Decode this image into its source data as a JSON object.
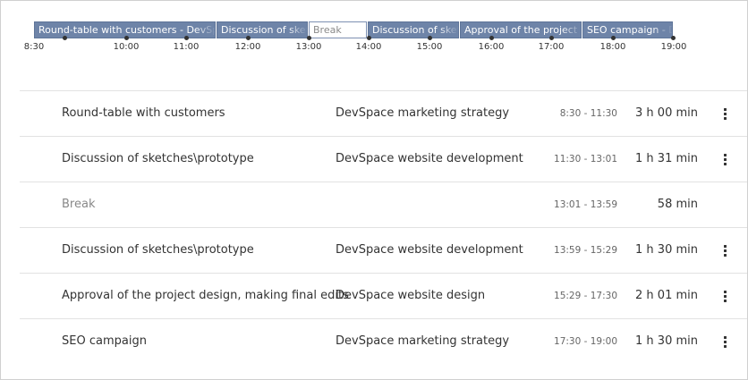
{
  "timeline": {
    "segments": [
      {
        "label": "Round-table with customers - DevSpace marketing strategy"
      },
      {
        "label": "Discussion of sketches\\prototype"
      },
      {
        "label": "Break"
      },
      {
        "label": "Discussion of sketches\\prototype"
      },
      {
        "label": "Approval of the project design, making final edits"
      },
      {
        "label": "SEO campaign - DevSpace marketing strategy"
      }
    ],
    "ticks": [
      "8:30",
      "10:00",
      "11:00",
      "12:00",
      "13:00",
      "14:00",
      "15:00",
      "16:00",
      "17:00",
      "18:00",
      "19:00"
    ]
  },
  "entries": [
    {
      "name": "Round-table with customers",
      "project": "DevSpace marketing strategy",
      "range": "8:30 - 11:30",
      "duration": "3 h 00 min"
    },
    {
      "name": "Discussion of sketches\\prototype",
      "project": "DevSpace website development",
      "range": "11:30 - 13:01",
      "duration": "1 h 31 min"
    },
    {
      "name": "Break",
      "project": "",
      "range": "13:01 - 13:59",
      "duration": "58 min"
    },
    {
      "name": "Discussion of sketches\\prototype",
      "project": "DevSpace website development",
      "range": "13:59 - 15:29",
      "duration": "1 h 30 min"
    },
    {
      "name": "Approval of the project design, making final edits",
      "project": "DevSpace website design",
      "range": "15:29 - 17:30",
      "duration": "2 h 01 min"
    },
    {
      "name": "SEO campaign",
      "project": "DevSpace marketing strategy",
      "range": "17:30 - 19:00",
      "duration": "1 h 30 min"
    }
  ],
  "icons": {
    "row_menu": "more-vertical-icon",
    "timeline_marker": "dot-marker-icon"
  },
  "colors": {
    "segment": "#6e84a8",
    "break_border": "#7d90b2",
    "muted_text": "#888888"
  }
}
